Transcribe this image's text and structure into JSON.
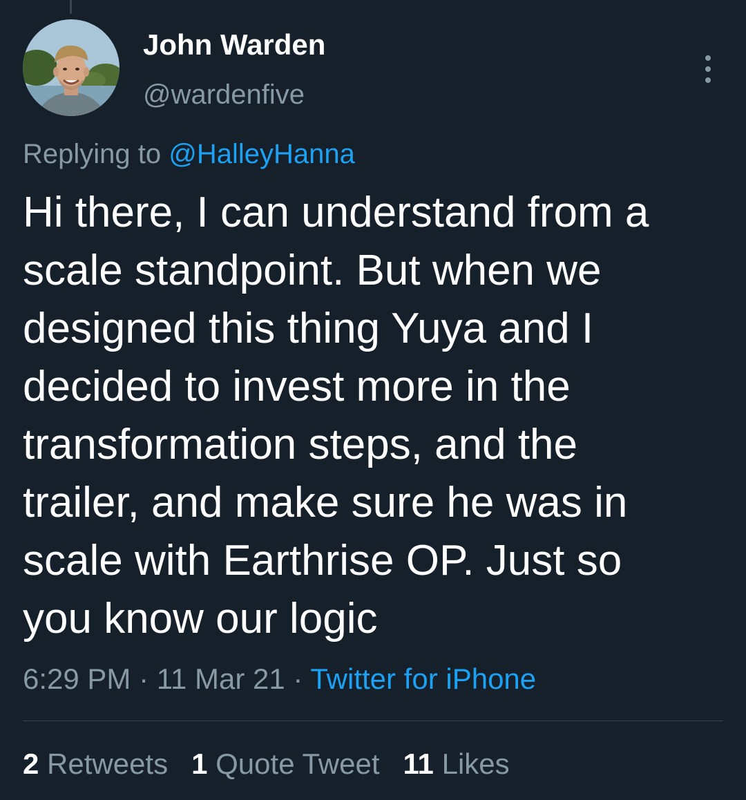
{
  "user": {
    "display_name": "John Warden",
    "handle": "@wardenfive"
  },
  "reply": {
    "prefix": "Replying to ",
    "mention": "@HalleyHanna"
  },
  "tweet": {
    "text": "Hi there, I can understand from a\nscale standpoint. But when we\ndesigned this thing Yuya and I\ndecided to invest more in the\ntransformation steps, and the\ntrailer, and make sure he was in\nscale with Earthrise OP. Just so\nyou know our logic"
  },
  "meta": {
    "time": "6:29 PM",
    "sep1": " · ",
    "date": "11 Mar 21",
    "sep2": " · ",
    "source": "Twitter for iPhone"
  },
  "stats": {
    "retweets_count": "2",
    "retweets_label": " Retweets",
    "quotes_count": "1",
    "quotes_label": " Quote Tweet",
    "likes_count": "11",
    "likes_label": " Likes"
  },
  "icons": {
    "more": "more-vertical-icon"
  },
  "colors": {
    "background": "#15202b",
    "primary_text": "#ffffff",
    "secondary_text": "#8899a6",
    "accent": "#1da1f2",
    "divider": "#38444d"
  }
}
